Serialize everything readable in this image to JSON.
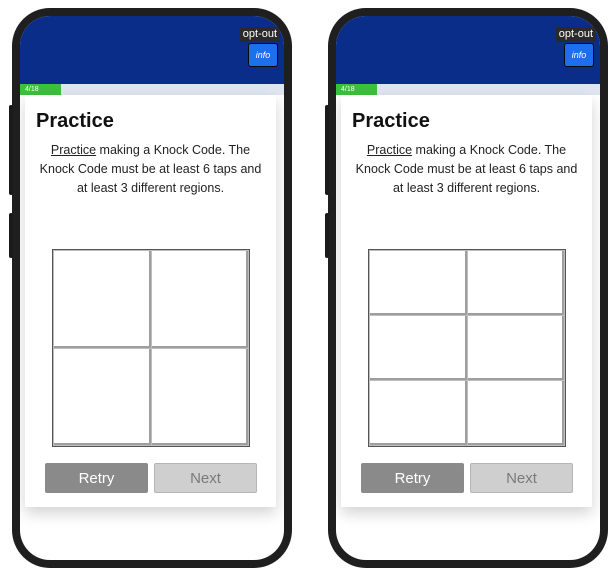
{
  "header": {
    "opt_out_label": "opt-out",
    "info_label": "info"
  },
  "progress": {
    "label": "4/18",
    "current": 4,
    "total": 18
  },
  "practice": {
    "title": "Practice",
    "link_text": "Practice",
    "instruction_rest": " making a Knock Code. The Knock Code must be at least 6 taps and at least 3 different regions."
  },
  "buttons": {
    "retry_label": "Retry",
    "next_label": "Next"
  },
  "colors": {
    "header_bg": "#0b2d8a",
    "info_button": "#1d6ff0",
    "progress_fill": "#3cc13c",
    "retry_button": "#8a8a8a",
    "next_button_disabled": "#cfcfcf"
  },
  "screens": [
    {
      "variant": "4-region grid",
      "regions": 4
    },
    {
      "variant": "6-region grid",
      "regions": 6
    }
  ]
}
